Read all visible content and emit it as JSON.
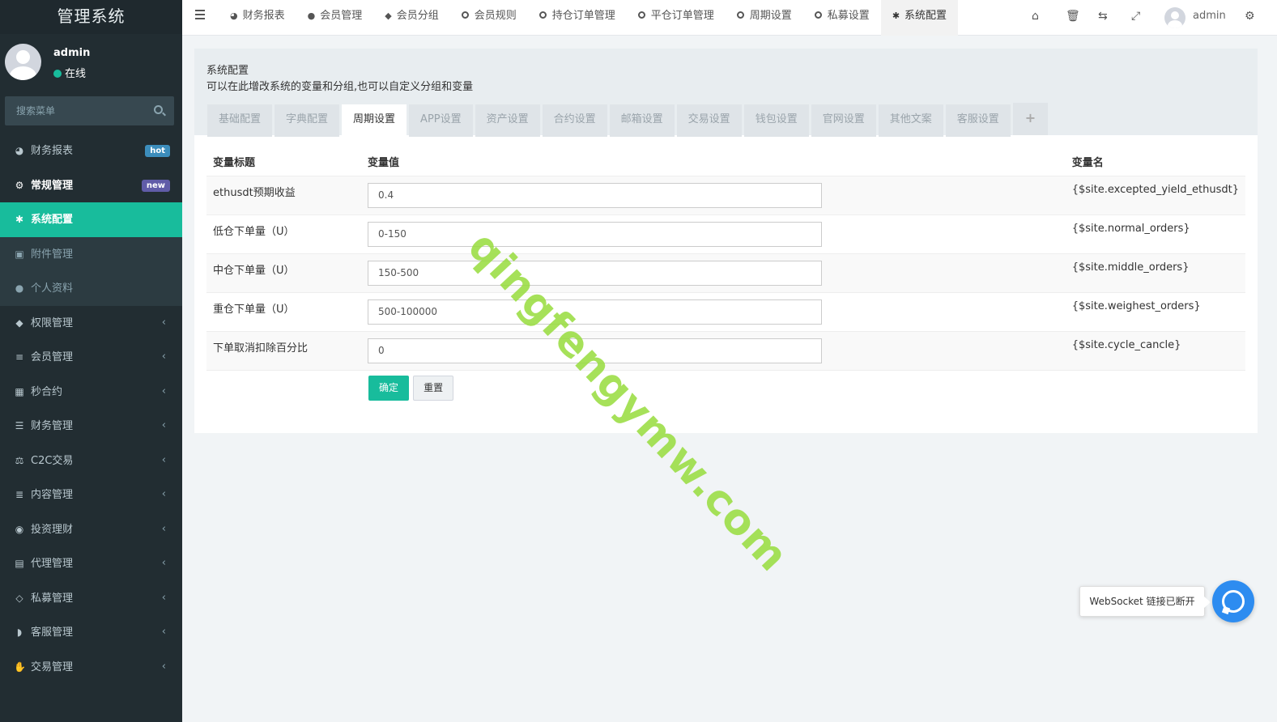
{
  "app": {
    "title": "管理系统"
  },
  "user": {
    "name": "admin",
    "status": "在线"
  },
  "search": {
    "placeholder": "搜索菜单"
  },
  "sidebar": {
    "items": [
      {
        "label": "财务报表",
        "icon": "dashboard-icon",
        "badge": "hot"
      },
      {
        "label": "常规管理",
        "icon": "cogs-icon",
        "badge": "new"
      },
      {
        "label": "系统配置",
        "icon": "gear-icon"
      },
      {
        "label": "附件管理",
        "icon": "image-icon"
      },
      {
        "label": "个人资料",
        "icon": "user-icon"
      },
      {
        "label": "权限管理",
        "icon": "group-icon"
      },
      {
        "label": "会员管理",
        "icon": "list-icon"
      },
      {
        "label": "秒合约",
        "icon": "calendar-icon"
      },
      {
        "label": "财务管理",
        "icon": "database-icon"
      },
      {
        "label": "C2C交易",
        "icon": "balance-scale-icon"
      },
      {
        "label": "内容管理",
        "icon": "align-left-icon"
      },
      {
        "label": "投资理财",
        "icon": "compass-icon"
      },
      {
        "label": "代理管理",
        "icon": "briefcase-icon"
      },
      {
        "label": "私募管理",
        "icon": "diamond-icon"
      },
      {
        "label": "客服管理",
        "icon": "comment-icon"
      },
      {
        "label": "交易管理",
        "icon": "handshake-icon"
      }
    ]
  },
  "topnav": {
    "tabs": [
      {
        "label": "财务报表",
        "icon": "dashboard-icon"
      },
      {
        "label": "会员管理",
        "icon": "user-icon"
      },
      {
        "label": "会员分组",
        "icon": "group-icon"
      },
      {
        "label": "会员规则",
        "icon": "circle-icon"
      },
      {
        "label": "持仓订单管理",
        "icon": "circle-icon"
      },
      {
        "label": "平仓订单管理",
        "icon": "circle-icon"
      },
      {
        "label": "周期设置",
        "icon": "circle-icon"
      },
      {
        "label": "私募设置",
        "icon": "circle-icon"
      },
      {
        "label": "系统配置",
        "icon": "gear-icon"
      }
    ],
    "admin_name": "admin"
  },
  "panel": {
    "title": "系统配置",
    "description": "可以在此增改系统的变量和分组,也可以自定义分组和变量",
    "tabs": [
      "基础配置",
      "字典配置",
      "周期设置",
      "APP设置",
      "资产设置",
      "合约设置",
      "邮箱设置",
      "交易设置",
      "钱包设置",
      "官网设置",
      "其他文案",
      "客服设置",
      "+"
    ],
    "active_tab": "周期设置",
    "columns": {
      "title": "变量标题",
      "value": "变量值",
      "name": "变量名"
    },
    "rows": [
      {
        "title": "ethusdt预期收益",
        "value": "0.4",
        "name": "{$site.excepted_yield_ethusdt}"
      },
      {
        "title": "低仓下单量（U）",
        "value": "0-150",
        "name": "{$site.normal_orders}"
      },
      {
        "title": "中仓下单量（U）",
        "value": "150-500",
        "name": "{$site.middle_orders}"
      },
      {
        "title": "重仓下单量（U）",
        "value": "500-100000",
        "name": "{$site.weighest_orders}"
      },
      {
        "title": "下单取消扣除百分比",
        "value": "0",
        "name": "{$site.cycle_cancle}"
      }
    ],
    "buttons": {
      "submit": "确定",
      "reset": "重置"
    }
  },
  "watermark": "qingfengymw.com",
  "toast": {
    "message": "WebSocket 链接已断开"
  },
  "colors": {
    "accent": "#18bc9c",
    "sidebar": "#222d32",
    "hot": "#3c8dbc",
    "new": "#605ca8",
    "chat": "#2d8cf0"
  }
}
